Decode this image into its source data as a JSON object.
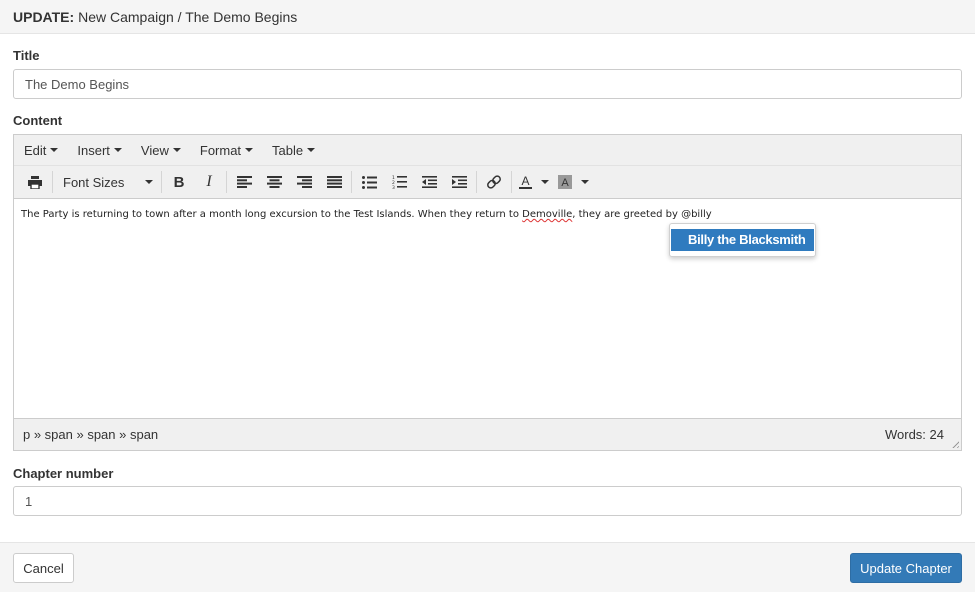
{
  "header": {
    "action": "UPDATE:",
    "title": "New Campaign / The Demo Begins"
  },
  "form": {
    "title_label": "Title",
    "title_value": "The Demo Begins",
    "content_label": "Content",
    "chapter_label": "Chapter number",
    "chapter_value": "1"
  },
  "editor": {
    "menus": [
      "Edit",
      "Insert",
      "View",
      "Format",
      "Table"
    ],
    "font_sizes_label": "Font Sizes",
    "toolbar_icons": [
      "print-icon",
      "bold-icon",
      "italic-icon",
      "align-left-icon",
      "align-center-icon",
      "align-right-icon",
      "align-justify-icon",
      "bullet-list-icon",
      "numbered-list-icon",
      "outdent-icon",
      "indent-icon",
      "link-icon",
      "text-color-icon",
      "background-color-icon"
    ],
    "content_before": "The Party is returning to town after a month long excursion to the Test Islands. When they return to ",
    "content_misspelled": "Demoville",
    "content_after": ", they are greeted by @billy",
    "path": "p » span » span » span",
    "word_count": "Words: 24"
  },
  "mention": {
    "suggestion": "Billy the Blacksmith"
  },
  "footer": {
    "cancel_label": "Cancel",
    "update_label": "Update Chapter"
  },
  "colors": {
    "primary": "#337ab7",
    "mention_highlight": "#2f7bbf"
  }
}
